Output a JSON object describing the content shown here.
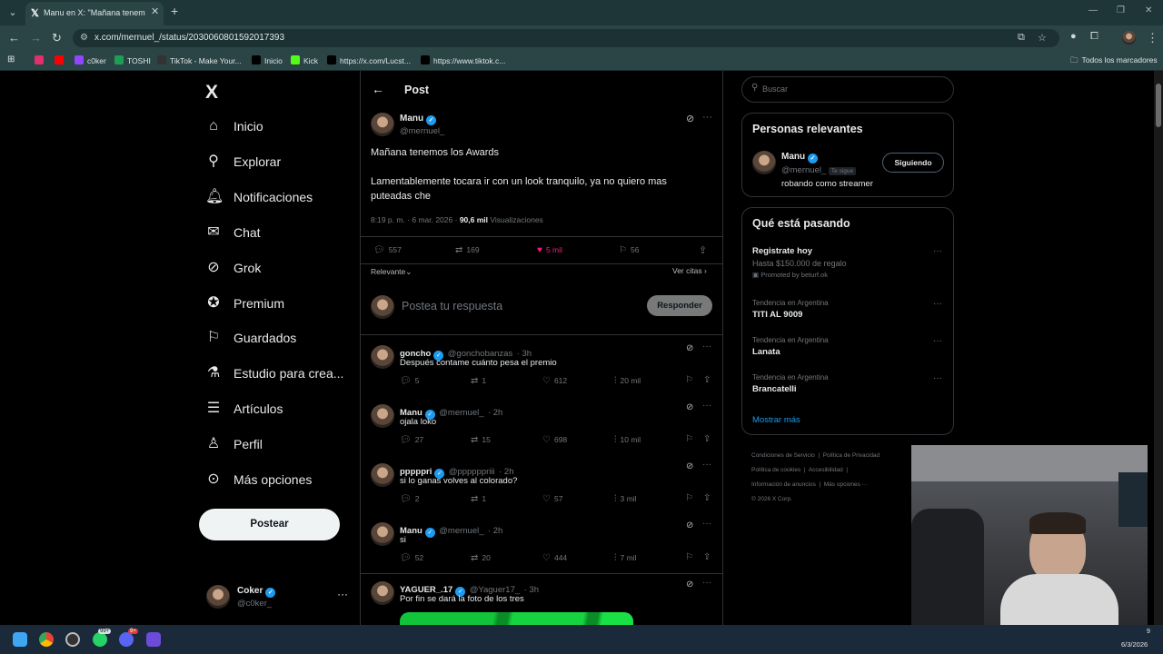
{
  "browser": {
    "tab_title": "Manu en X: \"Mañana tenemos l",
    "url": "x.com/mernuel_/status/2030060801592017393",
    "bookmarks": [
      {
        "label": "",
        "color": "#e1306c"
      },
      {
        "label": "",
        "color": "#ff0000"
      },
      {
        "label": "c0ker",
        "color": "#9146ff"
      },
      {
        "label": "TOSHI",
        "color": "#1f9d55"
      },
      {
        "label": "TikTok - Make Your...",
        "color": "#333333"
      },
      {
        "label": "Inicio",
        "color": "#000000"
      },
      {
        "label": "Kick",
        "color": "#53fc18"
      },
      {
        "label": "https://x.com/Lucst...",
        "color": "#000000"
      },
      {
        "label": "https://www.tiktok.c...",
        "color": "#000000"
      }
    ],
    "bookmarks_all": "Todos los marcadores"
  },
  "sidebar": {
    "logo": "X",
    "items": [
      {
        "label": "Inicio",
        "icon": "home-icon"
      },
      {
        "label": "Explorar",
        "icon": "search-icon"
      },
      {
        "label": "Notificaciones",
        "icon": "bell-icon"
      },
      {
        "label": "Chat",
        "icon": "mail-icon"
      },
      {
        "label": "Grok",
        "icon": "grok-icon"
      },
      {
        "label": "Premium",
        "icon": "verified-icon"
      },
      {
        "label": "Guardados",
        "icon": "bookmark-icon"
      },
      {
        "label": "Estudio para crea...",
        "icon": "flask-icon"
      },
      {
        "label": "Artículos",
        "icon": "article-icon"
      },
      {
        "label": "Perfil",
        "icon": "person-icon"
      },
      {
        "label": "Más opciones",
        "icon": "more-icon"
      }
    ],
    "post_button": "Postear",
    "account": {
      "name": "Coker",
      "handle": "@c0ker_"
    }
  },
  "post": {
    "header_title": "Post",
    "author": {
      "name": "Manu",
      "handle": "@mernuel_"
    },
    "text_line1": "Mañana tenemos los Awards",
    "text_line2": "Lamentablemente tocara ir con un look tranquilo, ya no quiero mas",
    "text_line3": "puteadas che",
    "time": "8:19 p. m. · 6 mar. 2026 ·",
    "views": "90,6 mil",
    "views_label": "Visualizaciones",
    "replies": "557",
    "reposts": "169",
    "likes": "5 mil",
    "bookmarks": "56",
    "sort_label": "Relevante",
    "quotes_label": "Ver citas",
    "reply_placeholder": "Postea tu respuesta",
    "reply_button": "Responder"
  },
  "replies": [
    {
      "name": "goncho",
      "handle": "@gonchobanzas",
      "time": "· 3h",
      "text": "Después contame cuánto pesa el premio",
      "replies": "5",
      "reposts": "1",
      "likes": "612",
      "views": "20 mil"
    },
    {
      "name": "Manu",
      "handle": "@mernuel_",
      "time": "· 2h",
      "text": "ojala loko",
      "replies": "27",
      "reposts": "15",
      "likes": "698",
      "views": "10 mil"
    },
    {
      "name": "pppppri",
      "handle": "@ppppppriii",
      "time": "· 2h",
      "text": "si lo ganas volves al colorado?",
      "replies": "2",
      "reposts": "1",
      "likes": "57",
      "views": "3 mil"
    },
    {
      "name": "Manu",
      "handle": "@mernuel_",
      "time": "· 2h",
      "text": "si",
      "replies": "52",
      "reposts": "20",
      "likes": "444",
      "views": "7 mil"
    },
    {
      "name": "YAGUER_.17",
      "handle": "@Yaguer17_",
      "time": "· 3h",
      "text": "Por fin se dará la foto de los tres"
    }
  ],
  "right": {
    "search_placeholder": "Buscar",
    "relevant_title": "Personas relevantes",
    "relevant_person": {
      "name": "Manu",
      "handle": "@mernuel_",
      "follows_you": "Te sigue",
      "bio": "robando como streamer",
      "button": "Siguiendo"
    },
    "trending_title": "Qué está pasando",
    "promo": {
      "title": "Registrate hoy",
      "subtitle": "Hasta $150.000 de regalo",
      "promoted": "Promoted by beturf.ok"
    },
    "trends": [
      {
        "category": "Tendencia en Argentina",
        "title": "TITI AL 9009"
      },
      {
        "category": "Tendencia en Argentina",
        "title": "Lanata"
      },
      {
        "category": "Tendencia en Argentina",
        "title": "Brancatelli"
      }
    ],
    "show_more": "Mostrar más",
    "footer": [
      "Condiciones de Servicio",
      "Política de Privacidad",
      "Política de cookies",
      "Accesibilidad",
      "Información de anuncios",
      "Más opciones ···",
      "© 2026 X Corp."
    ]
  },
  "taskbar": {
    "date": "6/3/2026",
    "time_fragment": "9",
    "badge_whatsapp": "99+",
    "badge_discord": "9+"
  },
  "colors": {
    "accent": "#1d9bf0",
    "like": "#f91880",
    "bg": "#000000"
  }
}
